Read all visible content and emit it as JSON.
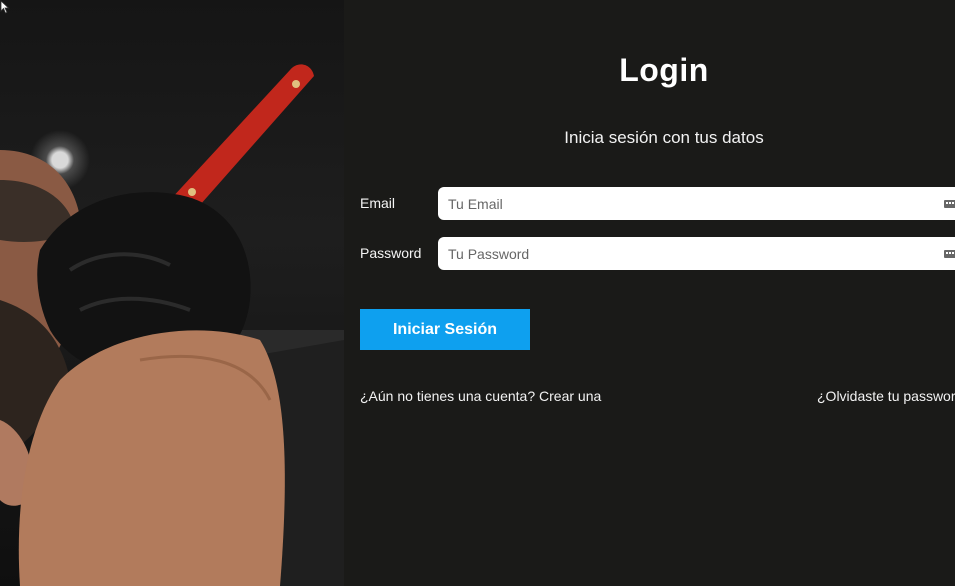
{
  "login": {
    "title": "Login",
    "subtitle": "Inicia sesión con tus datos",
    "email_label": "Email",
    "email_placeholder": "Tu Email",
    "password_label": "Password",
    "password_placeholder": "Tu Password",
    "submit_label": "Iniciar Sesión",
    "register_link": "¿Aún no tienes una cuenta? Crear una",
    "forgot_link": "¿Olvidaste tu password?"
  },
  "colors": {
    "background": "#1a1a18",
    "accent": "#0ea0ef",
    "text": "#ffffff"
  },
  "icons": {
    "field_icon": "password-manager-icon",
    "cursor": "mouse-pointer-icon"
  }
}
